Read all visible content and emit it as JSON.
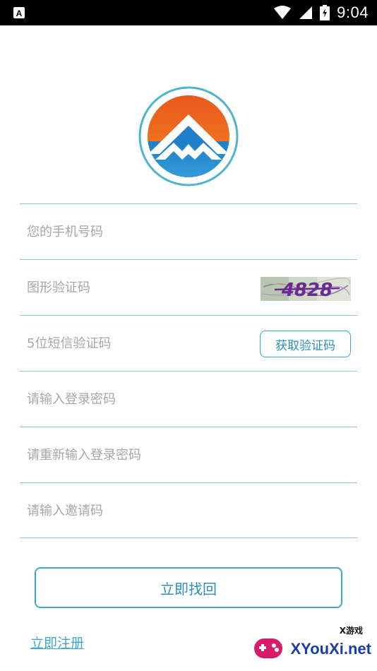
{
  "status_bar": {
    "time": "9:04",
    "icons": [
      "notification-a-icon",
      "wifi-icon",
      "signal-icon",
      "battery-charging-icon"
    ]
  },
  "logo": {
    "icon": "mountain-logo-icon",
    "colors": {
      "top": "#e8531c",
      "bottom": "#2b93d1",
      "ring": "#4fb3c9"
    }
  },
  "form": {
    "phone_placeholder": "您的手机号码",
    "image_code_placeholder": "图形验证码",
    "captcha_text": "4828",
    "sms_code_placeholder": "5位短信验证码",
    "get_code_label": "获取验证码",
    "password_placeholder": "请输入登录密码",
    "password_confirm_placeholder": "请重新输入登录密码",
    "invite_placeholder": "请输入邀请码"
  },
  "actions": {
    "submit_label": "立即找回",
    "register_label": "立即注册"
  },
  "watermark": {
    "small_text": "X游戏",
    "big_text": "XYouXi.net"
  },
  "colors": {
    "accent": "#3fa7c7",
    "divider": "#8cc9d8",
    "placeholder": "#a6a6a6"
  }
}
